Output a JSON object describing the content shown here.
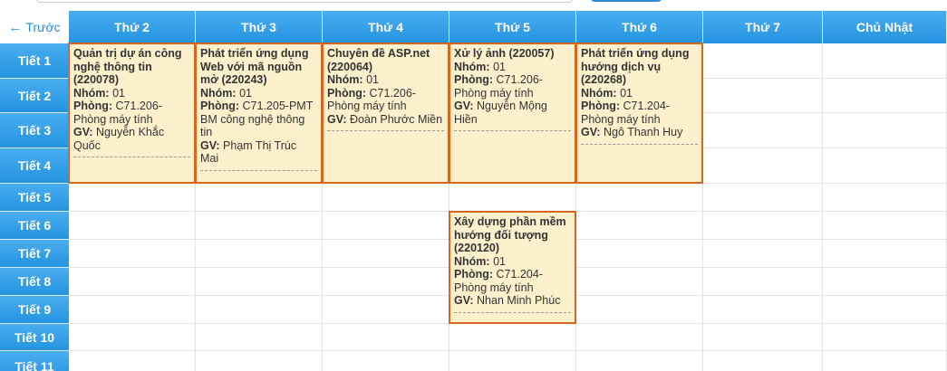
{
  "nav": {
    "prev_label": "Trước",
    "prev_icon": "arrow-left-icon"
  },
  "days": [
    "Thứ 2",
    "Thứ 3",
    "Thứ 4",
    "Thứ 5",
    "Thứ 6",
    "Thứ 7",
    "Chủ Nhật"
  ],
  "periods": [
    "Tiết 1",
    "Tiết 2",
    "Tiết 3",
    "Tiết 4",
    "Tiết 5",
    "Tiết 6",
    "Tiết 7",
    "Tiết 8",
    "Tiết 9",
    "Tiết 10",
    "Tiết 11"
  ],
  "labels": {
    "group": "Nhóm:",
    "room": "Phòng:",
    "teacher": "GV:"
  },
  "events": [
    {
      "day": 0,
      "start": 0,
      "span": 4,
      "title": "Quản trị dự án công nghệ thông tin (220078)",
      "group": "01",
      "room": "C71.206-Phòng máy tính",
      "teacher": "Nguyễn Khắc Quốc"
    },
    {
      "day": 1,
      "start": 0,
      "span": 4,
      "title": "Phát triển ứng dụng Web với mã nguồn mở (220243)",
      "group": "01",
      "room": "C71.205-PMT BM công nghệ thông tin",
      "teacher": "Phạm Thị Trúc Mai"
    },
    {
      "day": 2,
      "start": 0,
      "span": 4,
      "title": "Chuyên đề ASP.net (220064)",
      "group": "01",
      "room": "C71.206-Phòng máy tính",
      "teacher": "Đoàn Phước Miền"
    },
    {
      "day": 3,
      "start": 0,
      "span": 4,
      "title": "Xử lý ảnh (220057)",
      "group": "01",
      "room": "C71.206-Phòng máy tính",
      "teacher": "Nguyễn Mộng Hiền"
    },
    {
      "day": 4,
      "start": 0,
      "span": 4,
      "title": "Phát triển ứng dụng hướng dịch vụ (220268)",
      "group": "01",
      "room": "C71.204-Phòng máy tính",
      "teacher": "Ngô Thanh Huy"
    },
    {
      "day": 3,
      "start": 5,
      "span": 4,
      "title": "Xây dựng phần mềm hướng đối tượng (220120)",
      "group": "01",
      "room": "C71.204-Phòng máy tính",
      "teacher": "Nhan Minh Phúc"
    }
  ]
}
